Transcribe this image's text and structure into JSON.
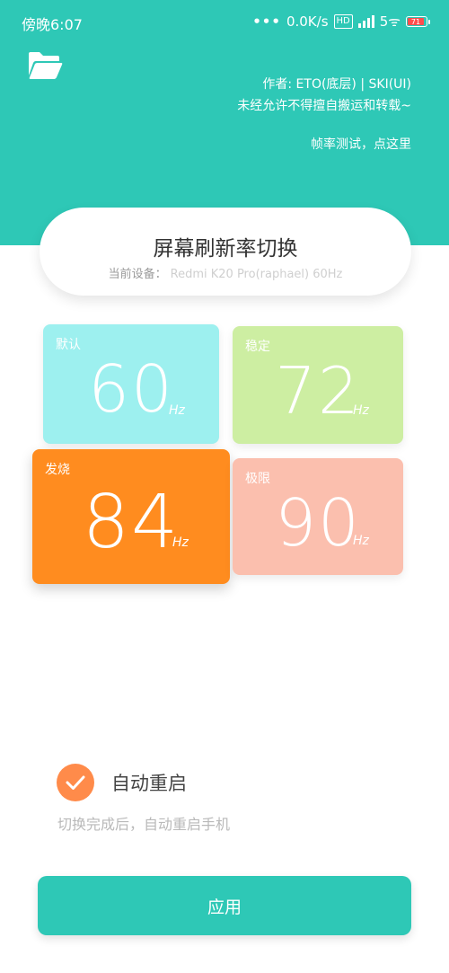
{
  "status_bar": {
    "time": "傍晚6:07",
    "network_speed": "0.0K/s",
    "volte": "VoLTE",
    "wifi": "5",
    "battery": "71"
  },
  "header": {
    "folder_icon": "folder-open-icon",
    "author": "作者: ETO(底层) | SKI(UI)",
    "notice": "未经允许不得擅自搬运和转载~",
    "fps_test": "帧率测试，点这里"
  },
  "title_card": {
    "title": "屏幕刷新率切换",
    "device_label": "当前设备：",
    "device_name": "Redmi K20 Pro(raphael) 60Hz"
  },
  "modes": [
    {
      "label": "默认",
      "value": "60",
      "unit": "Hz",
      "color": "#9df0ef"
    },
    {
      "label": "稳定",
      "value": "72",
      "unit": "Hz",
      "color": "#cdeea2"
    },
    {
      "label": "发烧",
      "value": "84",
      "unit": "Hz",
      "color": "#ff8c1f"
    },
    {
      "label": "极限",
      "value": "90",
      "unit": "Hz",
      "color": "#fbbfae"
    }
  ],
  "auto_restart": {
    "checked": true,
    "label": "自动重启",
    "description": "切换完成后，自动重启手机"
  },
  "apply_button": {
    "label": "应用"
  },
  "colors": {
    "accent": "#2ec8b6",
    "check": "#ff8b4a"
  }
}
